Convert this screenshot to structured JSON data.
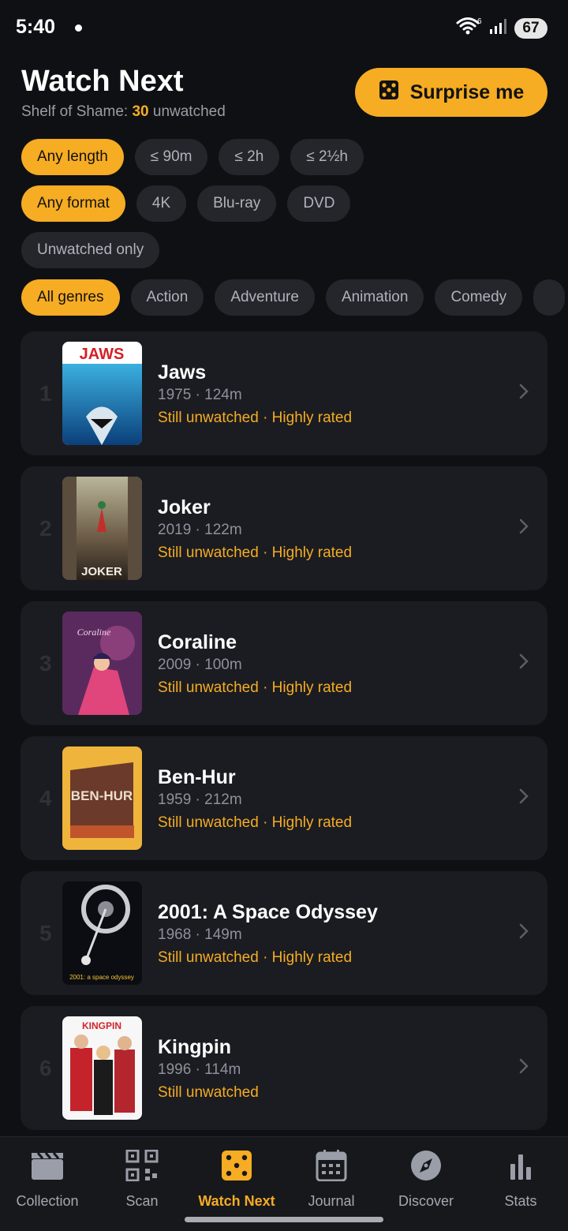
{
  "status": {
    "time": "5:40",
    "battery": "67",
    "wifi_badge": "6"
  },
  "header": {
    "title": "Watch Next",
    "subtitle_prefix": "Shelf of Shame: ",
    "unwatched_count": "30",
    "subtitle_suffix": " unwatched",
    "surprise_label": "Surprise me"
  },
  "filters": {
    "length": [
      "Any length",
      "≤ 90m",
      "≤ 2h",
      "≤ 2½h"
    ],
    "format": [
      "Any format",
      "4K",
      "Blu-ray",
      "DVD"
    ],
    "unwatched": "Unwatched only",
    "genres": [
      "All genres",
      "Action",
      "Adventure",
      "Animation",
      "Comedy"
    ]
  },
  "movies": [
    {
      "rank": "1",
      "title": "Jaws",
      "meta": "1975 · 124m",
      "tags": "Still unwatched · Highly rated",
      "poster_text": "JAWS"
    },
    {
      "rank": "2",
      "title": "Joker",
      "meta": "2019 · 122m",
      "tags": "Still unwatched · Highly rated",
      "poster_text": "JOKER"
    },
    {
      "rank": "3",
      "title": "Coraline",
      "meta": "2009 · 100m",
      "tags": "Still unwatched · Highly rated",
      "poster_text": "Coraline"
    },
    {
      "rank": "4",
      "title": "Ben-Hur",
      "meta": "1959 · 212m",
      "tags": "Still unwatched · Highly rated",
      "poster_text": "BEN-HUR"
    },
    {
      "rank": "5",
      "title": "2001: A Space Odyssey",
      "meta": "1968 · 149m",
      "tags": "Still unwatched · Highly rated",
      "poster_text": "2001: a space odyssey"
    },
    {
      "rank": "6",
      "title": "Kingpin",
      "meta": "1996 · 114m",
      "tags": "Still unwatched",
      "poster_text": "KINGPIN"
    }
  ],
  "nav": [
    {
      "label": "Collection",
      "icon": "clapperboard-icon"
    },
    {
      "label": "Scan",
      "icon": "qr-code-icon"
    },
    {
      "label": "Watch Next",
      "icon": "dice-icon"
    },
    {
      "label": "Journal",
      "icon": "calendar-icon"
    },
    {
      "label": "Discover",
      "icon": "compass-icon"
    },
    {
      "label": "Stats",
      "icon": "bar-chart-icon"
    }
  ],
  "colors": {
    "accent": "#f6ac23",
    "background": "#0f1013",
    "card": "#1a1c21",
    "chip": "#24262c"
  }
}
